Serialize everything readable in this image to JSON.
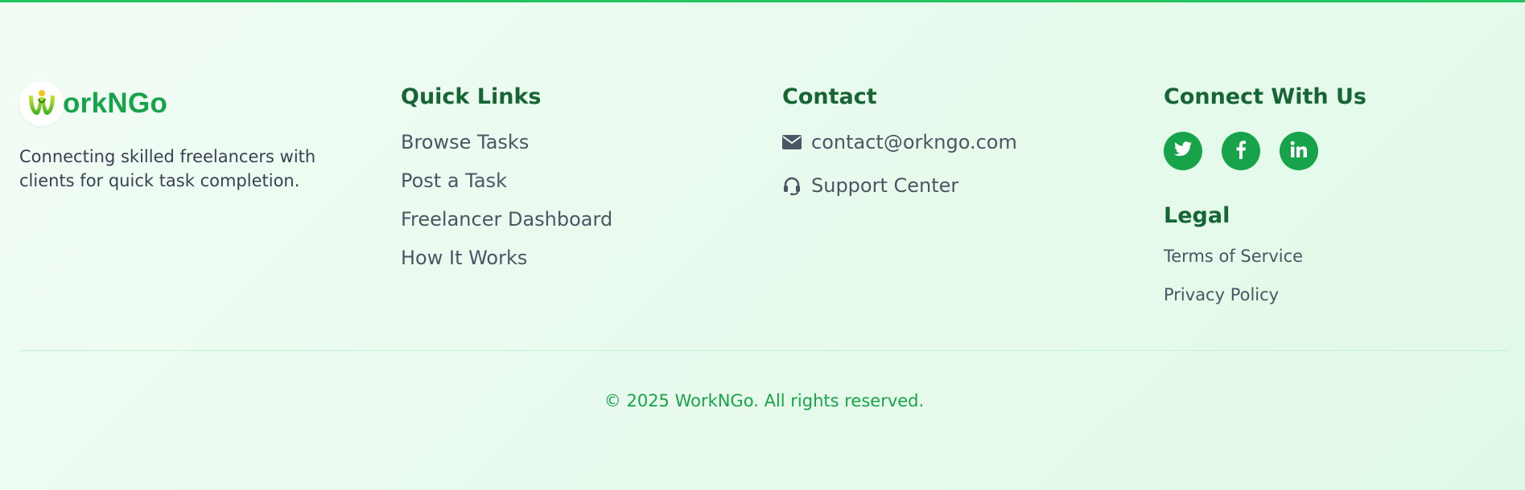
{
  "colors": {
    "accent": "#22c55e",
    "brand": "#16a34a",
    "heading": "#166534",
    "text": "#4b5563"
  },
  "brand": {
    "logo_icon": "worker-w-logo-icon",
    "name": "orkNGo",
    "description": "Connecting skilled freelancers with clients for quick task completion."
  },
  "quick_links": {
    "heading": "Quick Links",
    "items": [
      {
        "label": "Browse Tasks"
      },
      {
        "label": "Post a Task"
      },
      {
        "label": "Freelancer Dashboard"
      },
      {
        "label": "How It Works"
      }
    ]
  },
  "contact": {
    "heading": "Contact",
    "email": {
      "icon": "envelope-icon",
      "label": "contact@orkngo.com"
    },
    "support": {
      "icon": "headset-icon",
      "label": "Support Center"
    }
  },
  "connect": {
    "heading": "Connect With Us",
    "socials": [
      {
        "icon": "twitter-icon"
      },
      {
        "icon": "facebook-icon"
      },
      {
        "icon": "linkedin-icon"
      }
    ]
  },
  "legal": {
    "heading": "Legal",
    "items": [
      {
        "label": "Terms of Service"
      },
      {
        "label": "Privacy Policy"
      }
    ]
  },
  "footer": {
    "copyright": "© 2025 WorkNGo. All rights reserved."
  }
}
